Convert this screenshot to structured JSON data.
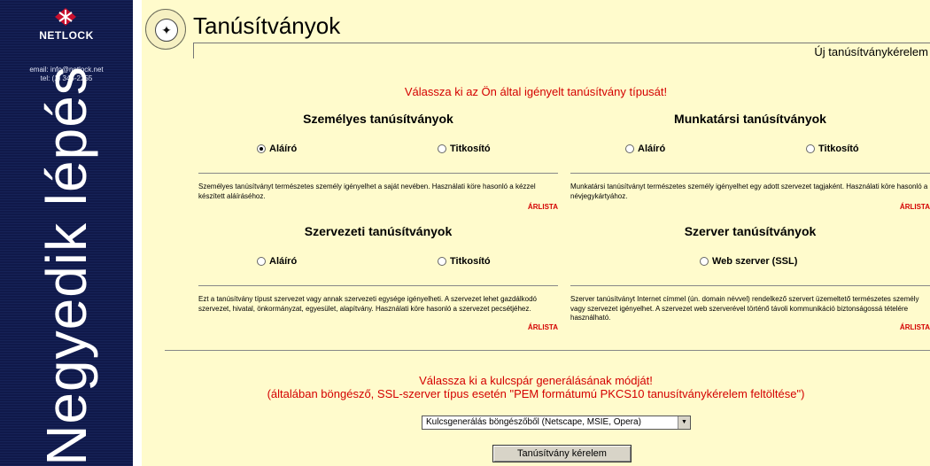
{
  "sidebar": {
    "logo_text": "NETLOCK",
    "email": "email: info@netlock.net",
    "tel": "tel: (1) 345-2255",
    "step_label": "Negyedik lépés"
  },
  "header": {
    "title": "Tanúsítványok",
    "new_request_link": "Új tanúsítványkérelem"
  },
  "instruction_select_type": "Válassza ki az Ön által igényelt tanúsítvány típusát!",
  "blocks": {
    "personal": {
      "title": "Személyes tanúsítványok",
      "options": [
        "Aláíró",
        "Titkosító"
      ],
      "selected": "Aláíró",
      "description": "Személyes tanúsítványt természetes személy igényelhet a saját nevében. Használati köre hasonló a kézzel készített aláíráséhoz.",
      "price_link": "ÁRLISTA"
    },
    "employee": {
      "title": "Munkatársi tanúsítványok",
      "options": [
        "Aláíró",
        "Titkosító"
      ],
      "description": "Munkatársi tanúsítványt természetes személy igényelhet egy adott szervezet tagjaként. Használati köre hasonló a névjegykártyához.",
      "price_link": "ÁRLISTA"
    },
    "organization": {
      "title": "Szervezeti tanúsítványok",
      "options": [
        "Aláíró",
        "Titkosító"
      ],
      "description": "Ezt a tanúsítvány típust szervezet vagy annak szervezeti egysége igényelheti. A szervezet lehet gazdálkodó szervezet, hivatal, önkormányzat, egyesület, alapítvány. Használati köre hasonló a szervezet pecsétjéhez.",
      "price_link": "ÁRLISTA"
    },
    "server": {
      "title": "Szerver tanúsítványok",
      "options": [
        "Web szerver (SSL)"
      ],
      "description": "Szerver tanúsítványt Internet címmel (ún. domain névvel) rendelkező szervert üzemeltető természetes személy vagy szervezet igényelhet. A szervezet web szerverével történő távoli kommunikáció biztonságossá tételére használható.",
      "price_link": "ÁRLISTA"
    }
  },
  "instruction_keygen_line1": "Válassza ki a kulcspár generálásának módját!",
  "instruction_keygen_line2": "(általában böngésző, SSL-szerver típus esetén \"PEM formátumú PKCS10 tanusítványkérelem feltöltése\")",
  "keygen_select": {
    "selected": "Kulcsgenerálás böngészőből (Netscape, MSIE, Opera)"
  },
  "submit_label": "Tanúsítvány kérelem",
  "colors": {
    "sidebar_bg": "#131d4f",
    "main_bg": "#fffbcc",
    "accent_red": "#d40000"
  }
}
